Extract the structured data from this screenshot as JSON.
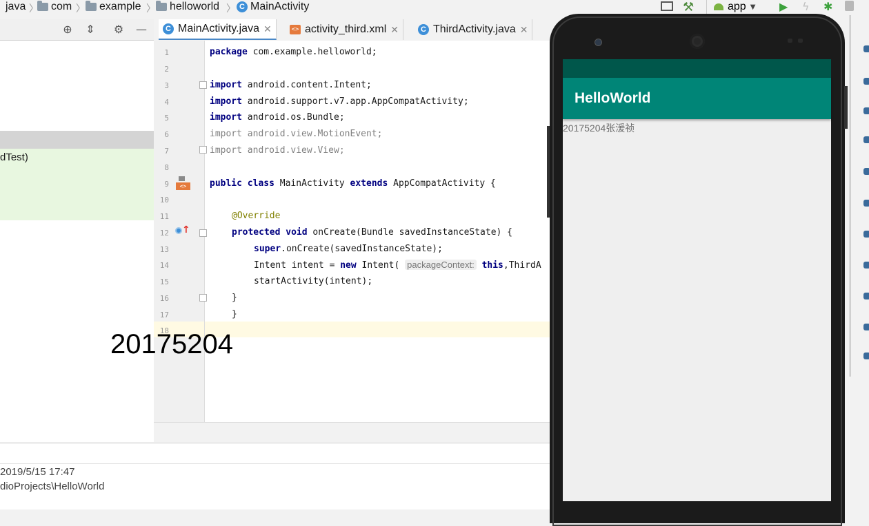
{
  "breadcrumb": {
    "items": [
      "java",
      "com",
      "example",
      "helloworld",
      "MainActivity"
    ]
  },
  "toolbar": {
    "run_config": "app"
  },
  "tabs": [
    {
      "label": "MainActivity.java",
      "icon": "class-icon",
      "active": true
    },
    {
      "label": "activity_third.xml",
      "icon": "xml-layout-icon",
      "active": false
    },
    {
      "label": "ThirdActivity.java",
      "icon": "class-icon",
      "active": false
    }
  ],
  "left_panel": {
    "partial_item": "dTest)"
  },
  "code": {
    "line_numbers": [
      "1",
      "2",
      "3",
      "4",
      "5",
      "6",
      "7",
      "8",
      "9",
      "10",
      "11",
      "12",
      "13",
      "14",
      "15",
      "16",
      "17",
      "18"
    ],
    "l1_kw": "package",
    "l1_rest": " com.example.helloworld;",
    "l3_kw": "import",
    "l3_rest": " android.content.Intent;",
    "l4_kw": "import",
    "l4_rest": " android.support.v7.app.AppCompatActivity;",
    "l5_kw": "import",
    "l5_rest": " android.os.Bundle;",
    "l6": "import android.view.MotionEvent;",
    "l7": "import android.view.View;",
    "l9_kw1": "public",
    "l9_kw2": "class",
    "l9_name": " MainActivity ",
    "l9_kw3": "extends",
    "l9_rest": " AppCompatActivity {",
    "l11": "@Override",
    "l12_kw1": "protected",
    "l12_kw2": "void",
    "l12_rest": " onCreate(Bundle savedInstanceState) {",
    "l13_kw": "super",
    "l13_rest": ".onCreate(savedInstanceState);",
    "l14_pre": "Intent intent = ",
    "l14_kw": "new",
    "l14_mid": " Intent(",
    "l14_hint": "packageContext:",
    "l14_kw2": "this",
    "l14_rest": ",ThirdA",
    "l15": "startActivity(intent);",
    "l16": "}",
    "l17": "}"
  },
  "overlay_number": "20175204",
  "bottom": {
    "timestamp": "2019/5/15 17:47",
    "path": "dioProjects\\HelloWorld"
  },
  "phone": {
    "app_title": "HelloWorld",
    "text_view": "20175204张湲祯",
    "colors": {
      "status_bar": "#00574b",
      "app_bar": "#008577"
    }
  }
}
